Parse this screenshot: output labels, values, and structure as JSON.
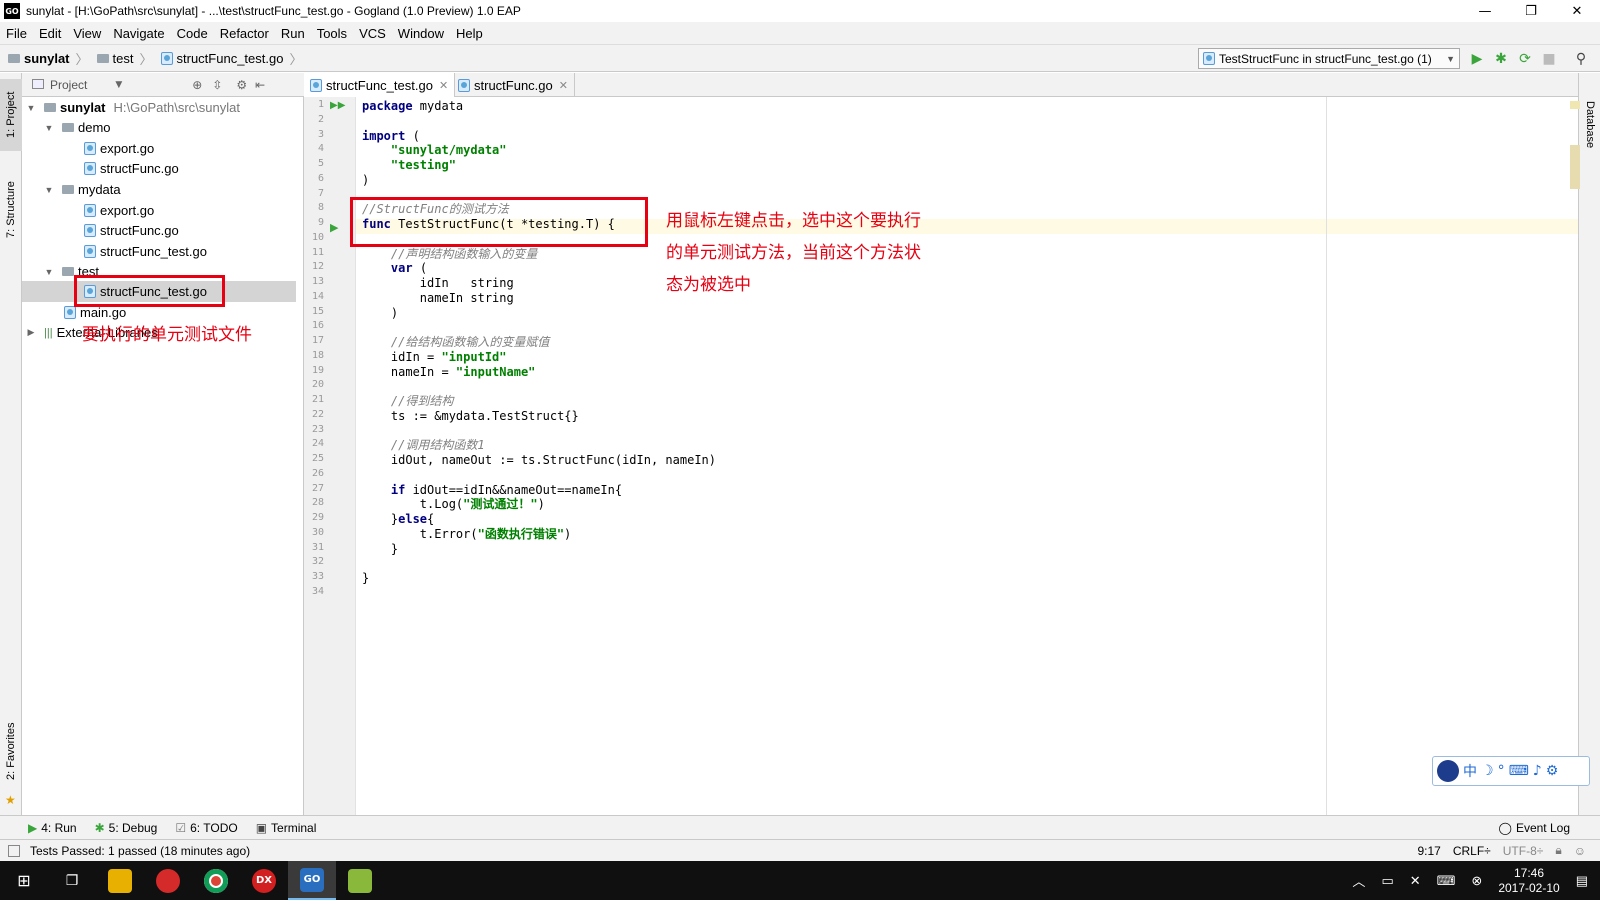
{
  "window": {
    "title": "sunylat - [H:\\GoPath\\src\\sunylat] - ...\\test\\structFunc_test.go - Gogland (1.0 Preview) 1.0 EAP",
    "app_badge": "GO",
    "minimize": "—",
    "maximize": "❐",
    "close": "✕"
  },
  "menu": [
    "File",
    "Edit",
    "View",
    "Navigate",
    "Code",
    "Refactor",
    "Run",
    "Tools",
    "VCS",
    "Window",
    "Help"
  ],
  "breadcrumbs": [
    "sunylat",
    "test",
    "structFunc_test.go"
  ],
  "run_config": "TestStructFunc in structFunc_test.go (1)",
  "left_tools": {
    "project": "1: Project",
    "structure": "7: Structure",
    "favorites": "2: Favorites"
  },
  "right_tools": {
    "database": "Database"
  },
  "project_panel": {
    "header": "Project",
    "root": {
      "name": "sunylat",
      "path": "H:\\GoPath\\src\\sunylat"
    },
    "folders": {
      "demo": {
        "name": "demo",
        "files": [
          "export.go",
          "structFunc.go"
        ]
      },
      "mydata": {
        "name": "mydata",
        "files": [
          "export.go",
          "structFunc.go",
          "structFunc_test.go"
        ]
      },
      "test": {
        "name": "test",
        "files": [
          "structFunc_test.go"
        ]
      }
    },
    "main_file": "main.go",
    "external": "External Libraries"
  },
  "tabs": [
    {
      "label": "structFunc_test.go",
      "active": true
    },
    {
      "label": "structFunc.go",
      "active": false
    }
  ],
  "code_lines": [
    "package mydata",
    "",
    "import (",
    "    \"sunylat/mydata\"",
    "    \"testing\"",
    ")",
    "",
    "//StructFunc的测试方法",
    "func TestStructFunc(t *testing.T) {",
    "",
    "    //声明结构函数输入的变量",
    "    var (",
    "        idIn   string",
    "        nameIn string",
    "    )",
    "",
    "    //给结构函数输入的变量赋值",
    "    idIn = \"inputId\"",
    "    nameIn = \"inputName\"",
    "",
    "    //得到结构",
    "    ts := &mydata.TestStruct{}",
    "",
    "    //调用结构函数1",
    "    idOut, nameOut := ts.StructFunc(idIn, nameIn)",
    "",
    "    if idOut==idIn&&nameOut==nameIn{",
    "        t.Log(\"测试通过！\")",
    "    }else{",
    "        t.Error(\"函数执行错误\")",
    "    }",
    "",
    "}",
    ""
  ],
  "annotations": {
    "method_note_1": "用鼠标左键点击，选中这个要执行",
    "method_note_2": "的单元测试方法，当前这个方法状",
    "method_note_3": "态为被选中",
    "file_note": "要执行的单元测试文件"
  },
  "ime": {
    "mode": "中"
  },
  "bottom_tools": [
    {
      "icon": "run-icon",
      "label": "4: Run"
    },
    {
      "icon": "debug-icon",
      "label": "5: Debug"
    },
    {
      "icon": "todo-icon",
      "label": "6: TODO"
    },
    {
      "icon": "terminal-icon",
      "label": "Terminal"
    }
  ],
  "event_log": "Event Log",
  "status": {
    "message": "Tests Passed: 1 passed (18 minutes ago)",
    "position": "9:17",
    "line_sep": "CRLF÷",
    "encoding": "UTF-8÷"
  },
  "taskbar": {
    "time": "17:46",
    "date": "2017-02-10",
    "apps": [
      "file-explorer",
      "app-red",
      "chrome",
      "app-dx",
      "gogland",
      "app-green"
    ]
  },
  "colors": {
    "keyword": "#000080",
    "string": "#008000",
    "comment": "#808080",
    "annotation": "#e60012"
  }
}
